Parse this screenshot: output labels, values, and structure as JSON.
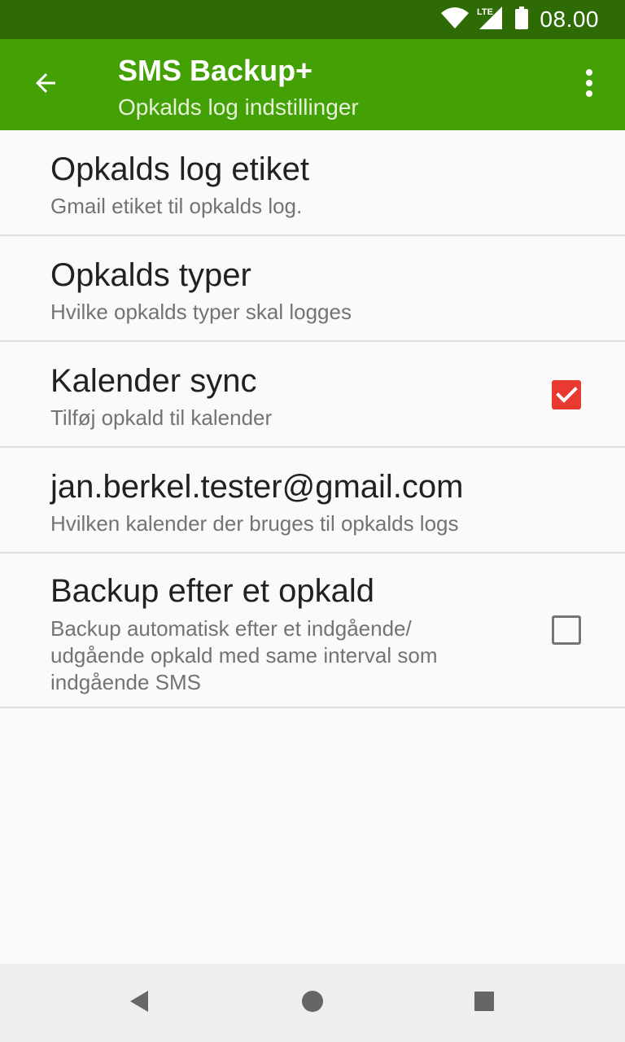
{
  "status_bar": {
    "network_label": "LTE",
    "time": "08.00",
    "icons": [
      "wifi-icon",
      "signal-icon",
      "battery-icon"
    ]
  },
  "app_bar": {
    "title": "SMS Backup+",
    "subtitle": "Opkalds log indstillinger",
    "back_icon": "arrow-back-icon",
    "menu_icon": "more-vert-icon"
  },
  "preferences": [
    {
      "title": "Opkalds log etiket",
      "summary": "Gmail etiket til opkalds log."
    },
    {
      "title": "Opkalds typer",
      "summary": "Hvilke opkalds typer skal logges"
    },
    {
      "title": "Kalender sync",
      "summary": "Tilføj opkald til kalender",
      "checked": true
    },
    {
      "title": "jan.berkel.tester@gmail.com",
      "summary": "Hvilken kalender der bruges til opkalds logs"
    },
    {
      "title": "Backup efter et opkald",
      "summary_lines": [
        "Backup automatisk efter et indgående/",
        "udgående opkald med same interval som",
        "indgående SMS"
      ],
      "checked": false
    }
  ],
  "nav_bar": {
    "icons": [
      "back-triangle-icon",
      "home-circle-icon",
      "recents-square-icon"
    ]
  },
  "colors": {
    "status_bar": "#2e6b04",
    "app_bar": "#43a005",
    "checkbox_accent": "#e83a30"
  }
}
